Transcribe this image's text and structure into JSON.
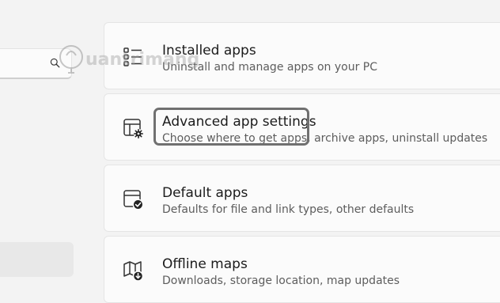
{
  "sidebar": {
    "search": {
      "placeholder": "",
      "icon": "search-icon"
    }
  },
  "watermark": {
    "text": "Quantrimang"
  },
  "cards": [
    {
      "title": "Installed apps",
      "description": "Uninstall and manage apps on your PC",
      "icon": "installed-apps-icon"
    },
    {
      "title": "Advanced app settings",
      "description": "Choose where to get apps, archive apps, uninstall updates",
      "icon": "advanced-app-settings-icon",
      "highlighted": true
    },
    {
      "title": "Default apps",
      "description": "Defaults for file and link types, other defaults",
      "icon": "default-apps-icon"
    },
    {
      "title": "Offline maps",
      "description": "Downloads, storage location, map updates",
      "icon": "offline-maps-icon"
    }
  ],
  "colors": {
    "background": "#f3f3f3",
    "card": "#fbfbfb",
    "highlight": "#707070"
  }
}
